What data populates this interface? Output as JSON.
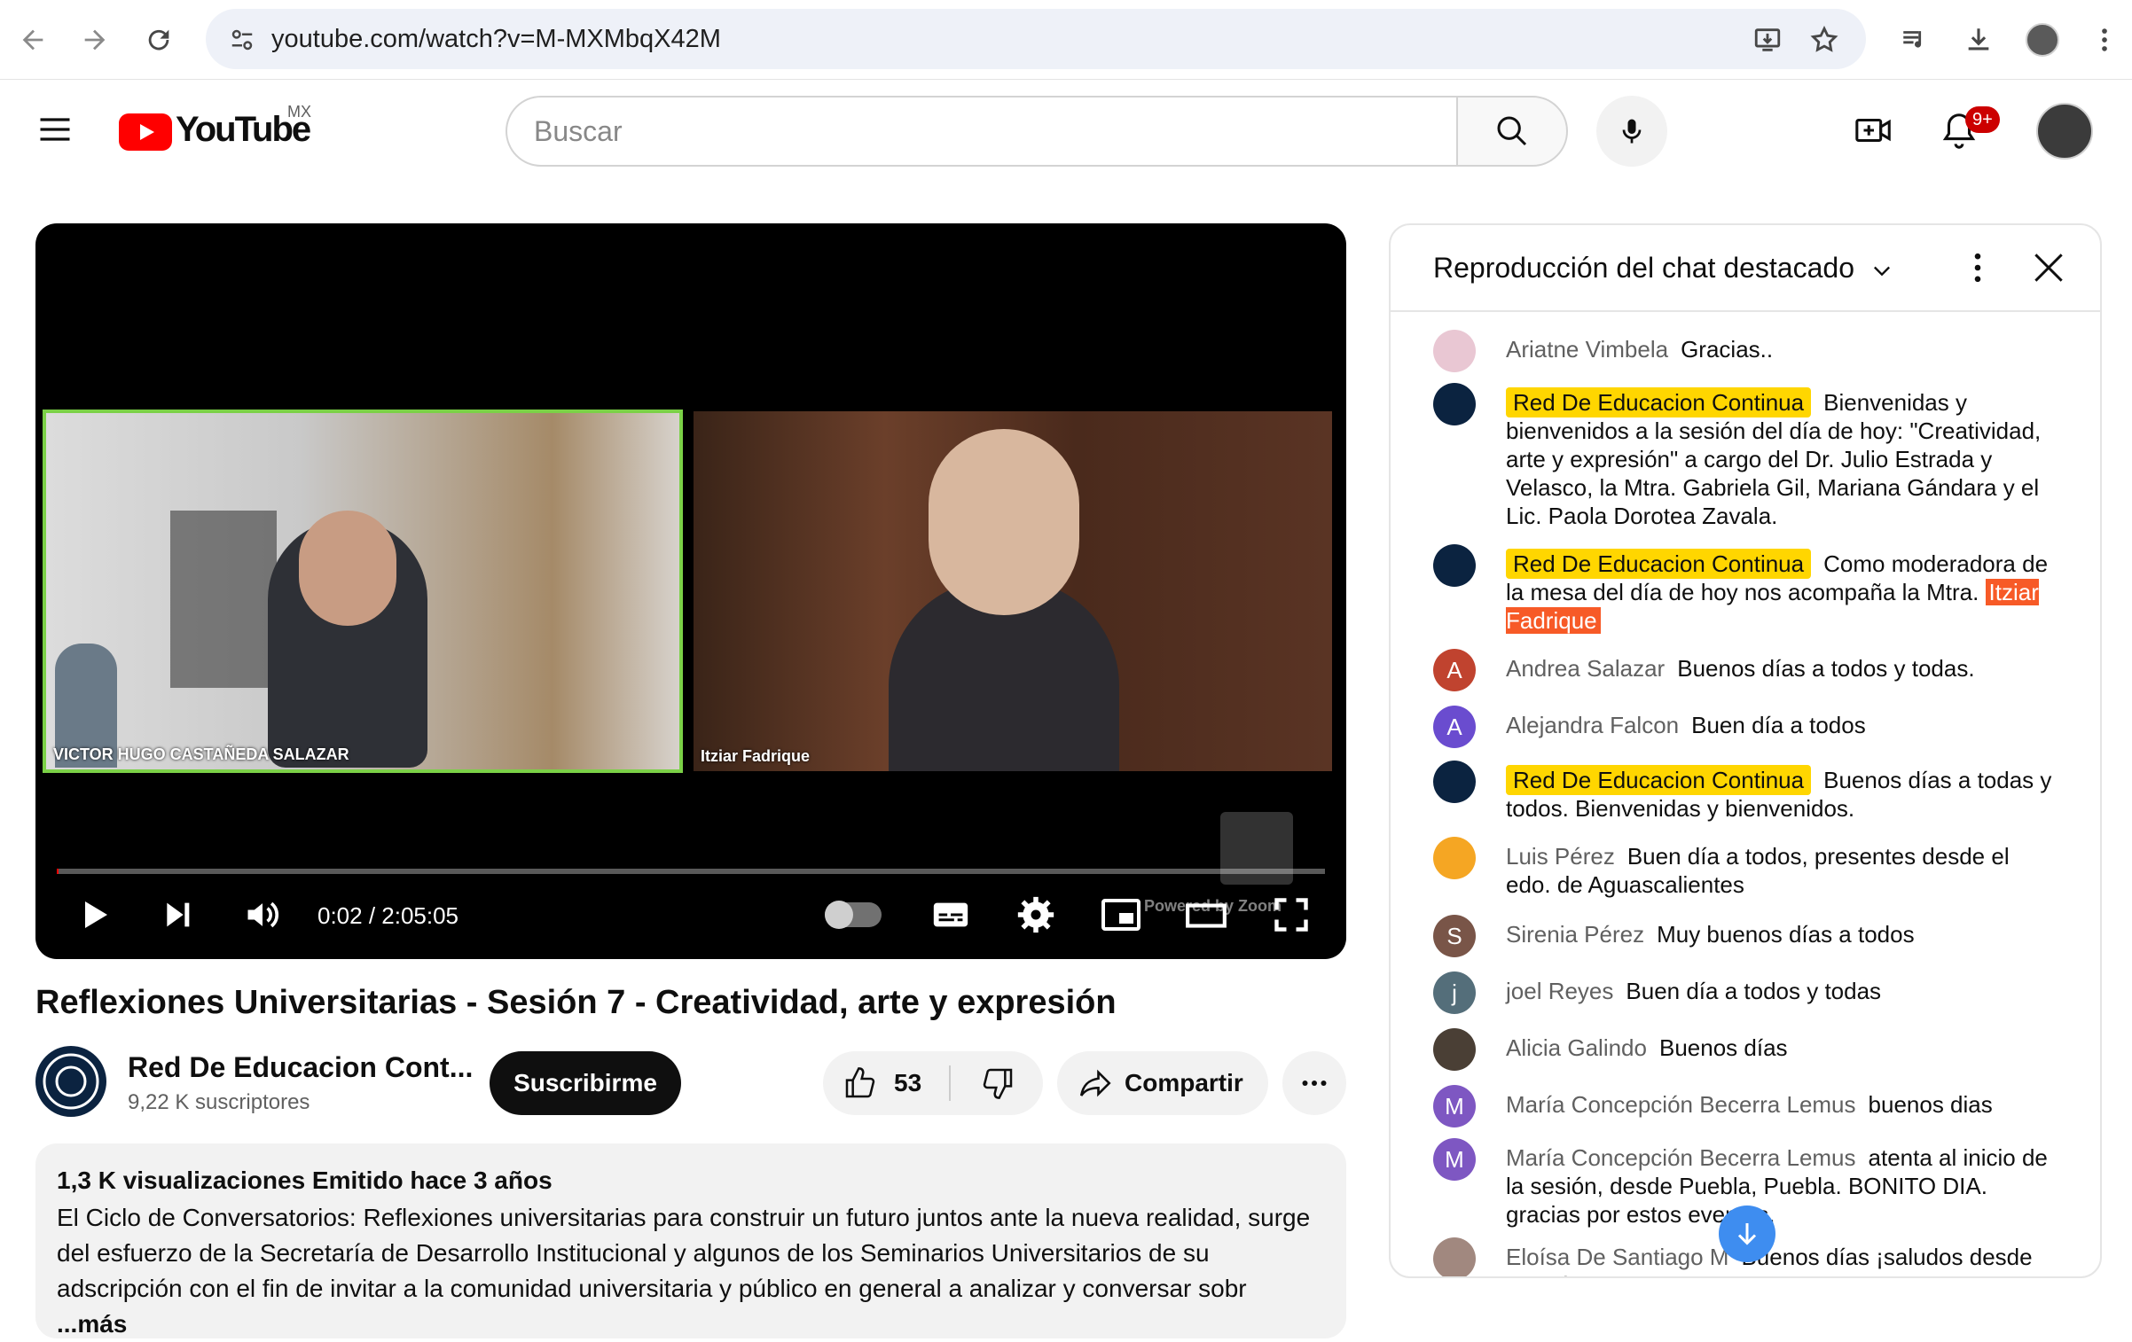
{
  "browser": {
    "url": "youtube.com/watch?v=M-MXMbqX42M"
  },
  "header": {
    "logo_text": "YouTube",
    "region": "MX",
    "search_placeholder": "Buscar",
    "notification_badge": "9+"
  },
  "player": {
    "speaker_left_name": "VICTOR HUGO CASTAÑEDA SALAZAR",
    "speaker_right_name": "Itziar Fadrique",
    "watermark": "Powered by Zoom",
    "time": "0:02 / 2:05:05",
    "progress": 0.0003
  },
  "video": {
    "title": "Reflexiones Universitarias - Sesión 7 - Creatividad, arte y expresión",
    "channel_name": "Red De Educacion Cont...",
    "subscribers": "9,22 K suscriptores",
    "subscribe_label": "Suscribirme",
    "likes": "53",
    "share_label": "Compartir"
  },
  "description": {
    "meta": "1,3 K visualizaciones  Emitido hace 3 años",
    "text": "El Ciclo de Conversatorios: Reflexiones universitarias para construir un futuro juntos ante la nueva realidad, surge del esfuerzo de la Secretaría de Desarrollo Institucional y algunos de los Seminarios Universitarios de su adscripción con el fin de invitar a la comunidad universitaria y público en general a analizar y conversar sobr",
    "more_label": "...más"
  },
  "chat": {
    "title": "Reproducción del chat destacado",
    "messages": [
      {
        "author": "Ariatne Vimbela",
        "text": "Gracias..",
        "avatar_letter": "",
        "avatar_color": "#e9c7d3",
        "mod": false
      },
      {
        "author": "Red De Educacion Continua",
        "text": "Bienvenidas y bienvenidos a la sesión del día de hoy: \"Creatividad, arte y expresión\" a cargo del Dr. Julio Estrada y Velasco, la Mtra. Gabriela Gil, Mariana Gándara y el Lic. Paola Dorotea Zavala.",
        "avatar_letter": "",
        "avatar_color": "#0b2340",
        "mod": true
      },
      {
        "author": "Red De Educacion Continua",
        "text": "Como moderadora de la mesa del día de hoy nos acompaña la Mtra.",
        "mention": "Itziar Fadrique",
        "avatar_letter": "",
        "avatar_color": "#0b2340",
        "mod": true
      },
      {
        "author": "Andrea Salazar",
        "text": "Buenos días a todos y todas.",
        "avatar_letter": "A",
        "avatar_color": "#c0432f",
        "mod": false
      },
      {
        "author": "Alejandra Falcon",
        "text": "Buen día a todos",
        "avatar_letter": "A",
        "avatar_color": "#6a4ccf",
        "mod": false
      },
      {
        "author": "Red De Educacion Continua",
        "text": "Buenos días a todas y todos. Bienvenidas y bienvenidos.",
        "avatar_letter": "",
        "avatar_color": "#0b2340",
        "mod": true
      },
      {
        "author": "Luis Pérez",
        "text": "Buen día a todos, presentes desde el edo. de Aguascalientes",
        "avatar_letter": "",
        "avatar_color": "#f5a623",
        "mod": false
      },
      {
        "author": "Sirenia Pérez",
        "text": "Muy buenos días a todos",
        "avatar_letter": "S",
        "avatar_color": "#795548",
        "mod": false
      },
      {
        "author": "joel Reyes",
        "text": "Buen día a todos y todas",
        "avatar_letter": "j",
        "avatar_color": "#546e7a",
        "mod": false
      },
      {
        "author": "Alicia Galindo",
        "text": "Buenos días",
        "avatar_letter": "",
        "avatar_color": "#4a3f35",
        "mod": false
      },
      {
        "author": "María Concepción Becerra Lemus",
        "text": "buenos dias",
        "avatar_letter": "M",
        "avatar_color": "#7e57c2",
        "mod": false
      },
      {
        "author": "María Concepción Becerra Lemus",
        "text": "atenta al inicio de la sesión, desde Puebla, Puebla. BONITO DIA. gracias por estos eventos.",
        "avatar_letter": "M",
        "avatar_color": "#7e57c2",
        "mod": false
      },
      {
        "author": "Eloísa De Santiago M",
        "text": "Buenos días ¡saludos desde Querétaro!",
        "avatar_letter": "",
        "avatar_color": "#a1887f",
        "mod": false
      }
    ]
  }
}
